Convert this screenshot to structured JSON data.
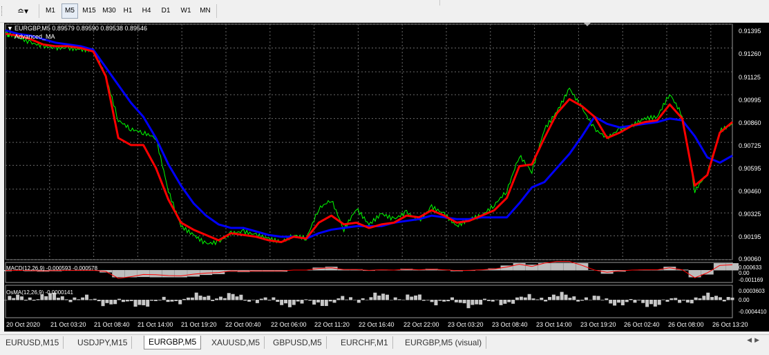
{
  "toolbar": {
    "timeframes": [
      "M1",
      "M5",
      "M15",
      "M30",
      "H1",
      "H4",
      "D1",
      "W1",
      "MN"
    ],
    "active_timeframe": "M5"
  },
  "main_chart": {
    "title": "EURGBP,M5  0.89579 0.89590 0.89538 0.89546",
    "indicator_label": "Advanced_MA",
    "colors": {
      "price": "#00ff00",
      "fast_ma": "#ff0000",
      "slow_ma": "#0000ff",
      "grid": "#6b6b6b"
    }
  },
  "macd": {
    "label": "MACD(12,26,9) -0.000593 -0.000578",
    "scale": [
      "0.000633",
      "0.00",
      "-0.001169"
    ]
  },
  "osma": {
    "label": "OsMA(12,26,9) -0.0000141",
    "scale": [
      "0.0003603",
      "0.00",
      "-0.0004410"
    ]
  },
  "chart_data": {
    "type": "line",
    "price_axis_ticks": [
      0.91395,
      0.9126,
      0.91125,
      0.90995,
      0.9086,
      0.90725,
      0.90595,
      0.9046,
      0.90325,
      0.90195,
      0.9006
    ],
    "price_axis_labels": [
      "0.91395",
      "0.91260",
      "0.91125",
      "0.90995",
      "0.90860",
      "0.90725",
      "0.90595",
      "0.90460",
      "0.90325",
      "0.90195",
      "0.90060"
    ],
    "time_labels": [
      "20 Oct 2020",
      "21 Oct 03:20",
      "21 Oct 08:40",
      "21 Oct 14:00",
      "21 Oct 19:20",
      "22 Oct 00:40",
      "22 Oct 06:00",
      "22 Oct 11:20",
      "22 Oct 16:40",
      "22 Oct 22:00",
      "23 Oct 03:20",
      "23 Oct 08:40",
      "23 Oct 14:00",
      "23 Oct 19:20",
      "26 Oct 02:40",
      "26 Oct 08:00",
      "26 Oct 13:20"
    ],
    "ylim": [
      0.9006,
      0.91395
    ],
    "fast_ma": [
      0.9134,
      0.9133,
      0.9131,
      0.9128,
      0.9127,
      0.9127,
      0.9126,
      0.9124,
      0.911,
      0.9075,
      0.9071,
      0.9071,
      0.9058,
      0.904,
      0.9027,
      0.9023,
      0.902,
      0.9017,
      0.9021,
      0.902,
      0.9019,
      0.9017,
      0.9016,
      0.9019,
      0.9018,
      0.9027,
      0.9031,
      0.9026,
      0.9027,
      0.9024,
      0.9026,
      0.9027,
      0.9031,
      0.903,
      0.9034,
      0.9031,
      0.9027,
      0.9028,
      0.9031,
      0.9034,
      0.9041,
      0.9059,
      0.906,
      0.9075,
      0.9089,
      0.9097,
      0.9093,
      0.9087,
      0.9075,
      0.9078,
      0.9082,
      0.9084,
      0.9085,
      0.9094,
      0.9086,
      0.9048,
      0.9054,
      0.9078,
      0.9084
    ],
    "slow_ma": [
      0.9136,
      0.9134,
      0.9133,
      0.9131,
      0.9129,
      0.9128,
      0.9127,
      0.9125,
      0.9115,
      0.9105,
      0.9095,
      0.9087,
      0.9075,
      0.906,
      0.9048,
      0.9038,
      0.9031,
      0.9026,
      0.9024,
      0.9024,
      0.9022,
      0.902,
      0.9019,
      0.9019,
      0.9018,
      0.9021,
      0.9023,
      0.9024,
      0.9025,
      0.9025,
      0.9025,
      0.9027,
      0.9028,
      0.9029,
      0.9031,
      0.903,
      0.9029,
      0.9029,
      0.903,
      0.903,
      0.903,
      0.9038,
      0.9047,
      0.905,
      0.9058,
      0.9066,
      0.9076,
      0.9087,
      0.9083,
      0.9081,
      0.9082,
      0.9083,
      0.9084,
      0.9086,
      0.9085,
      0.9076,
      0.9064,
      0.9061,
      0.9065
    ],
    "price": [
      0.9135,
      0.9132,
      0.9129,
      0.9127,
      0.9126,
      0.9126,
      0.9125,
      0.9125,
      0.911,
      0.9085,
      0.908,
      0.9078,
      0.9075,
      0.9045,
      0.9025,
      0.902,
      0.9015,
      0.9016,
      0.9021,
      0.9022,
      0.902,
      0.9018,
      0.9016,
      0.902,
      0.9018,
      0.9035,
      0.904,
      0.9023,
      0.9035,
      0.9026,
      0.9032,
      0.9029,
      0.9033,
      0.9028,
      0.9036,
      0.9032,
      0.9025,
      0.9029,
      0.9031,
      0.9037,
      0.9045,
      0.9065,
      0.9056,
      0.908,
      0.909,
      0.9103,
      0.9092,
      0.908,
      0.9075,
      0.908,
      0.9082,
      0.9086,
      0.9087,
      0.91,
      0.9088,
      0.9045,
      0.9055,
      0.9079,
      0.9083
    ]
  },
  "tabs": [
    {
      "label": "EURUSD,M15",
      "active": false
    },
    {
      "label": "USDJPY,M15",
      "active": false
    },
    {
      "label": "EURGBP,M5",
      "active": true
    },
    {
      "label": "XAUUSD,M5",
      "active": false
    },
    {
      "label": "GBPUSD,M5",
      "active": false
    },
    {
      "label": "EURCHF,M1",
      "active": false
    },
    {
      "label": "EURGBP,M5 (visual)",
      "active": false
    }
  ]
}
